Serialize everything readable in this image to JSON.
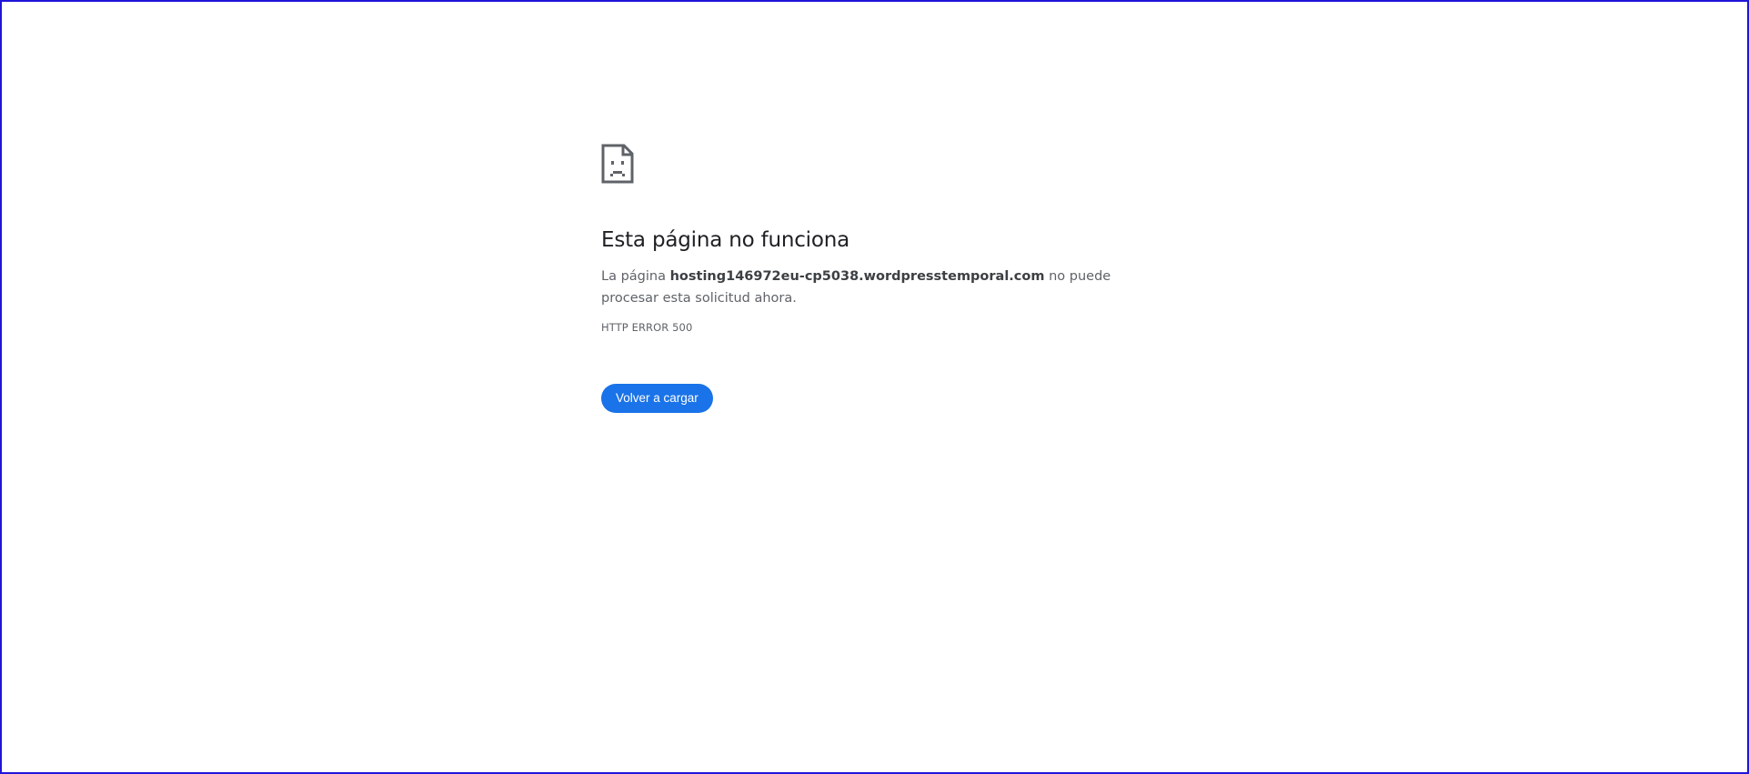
{
  "error": {
    "icon": "sad-page-icon",
    "title": "Esta página no funciona",
    "description_prefix": "La página ",
    "host": "hosting146972eu-cp5038.wordpresstemporal.com",
    "description_suffix": " no puede procesar esta solicitud ahora.",
    "code": "HTTP ERROR 500",
    "reload_label": "Volver a cargar"
  },
  "colors": {
    "accent": "#1a73e8",
    "title": "#202124",
    "text": "#5f6368",
    "frame": "#1f14d8"
  }
}
